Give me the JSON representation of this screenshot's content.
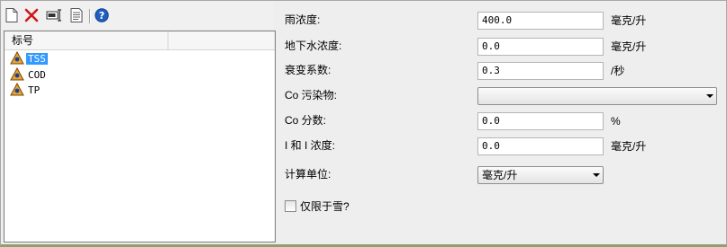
{
  "toolbar": {
    "icons": [
      "new-document-icon",
      "delete-icon",
      "rename-icon",
      "properties-icon",
      "help-icon"
    ]
  },
  "list": {
    "column_header": "标号",
    "items": [
      {
        "label": "TSS",
        "selected": true
      },
      {
        "label": "COD",
        "selected": false
      },
      {
        "label": "TP",
        "selected": false
      }
    ]
  },
  "form": {
    "rain_conc": {
      "label": "雨浓度:",
      "value": "400.0",
      "unit": "毫克/升"
    },
    "gw_conc": {
      "label": "地下水浓度:",
      "value": "0.0",
      "unit": "毫克/升"
    },
    "decay": {
      "label": "衰变系数:",
      "value": "0.3",
      "unit": "/秒"
    },
    "co_pollutant": {
      "label": "Co 污染物:",
      "value": ""
    },
    "co_fraction": {
      "label": "Co 分数:",
      "value": "0.0",
      "unit": "%"
    },
    "ii_conc": {
      "label": "I 和 I 浓度:",
      "value": "0.0",
      "unit": "毫克/升"
    },
    "calc_unit": {
      "label": "计算单位:",
      "value": "毫克/升"
    },
    "snow_only": {
      "label": "仅限于雪?",
      "checked": false
    }
  }
}
